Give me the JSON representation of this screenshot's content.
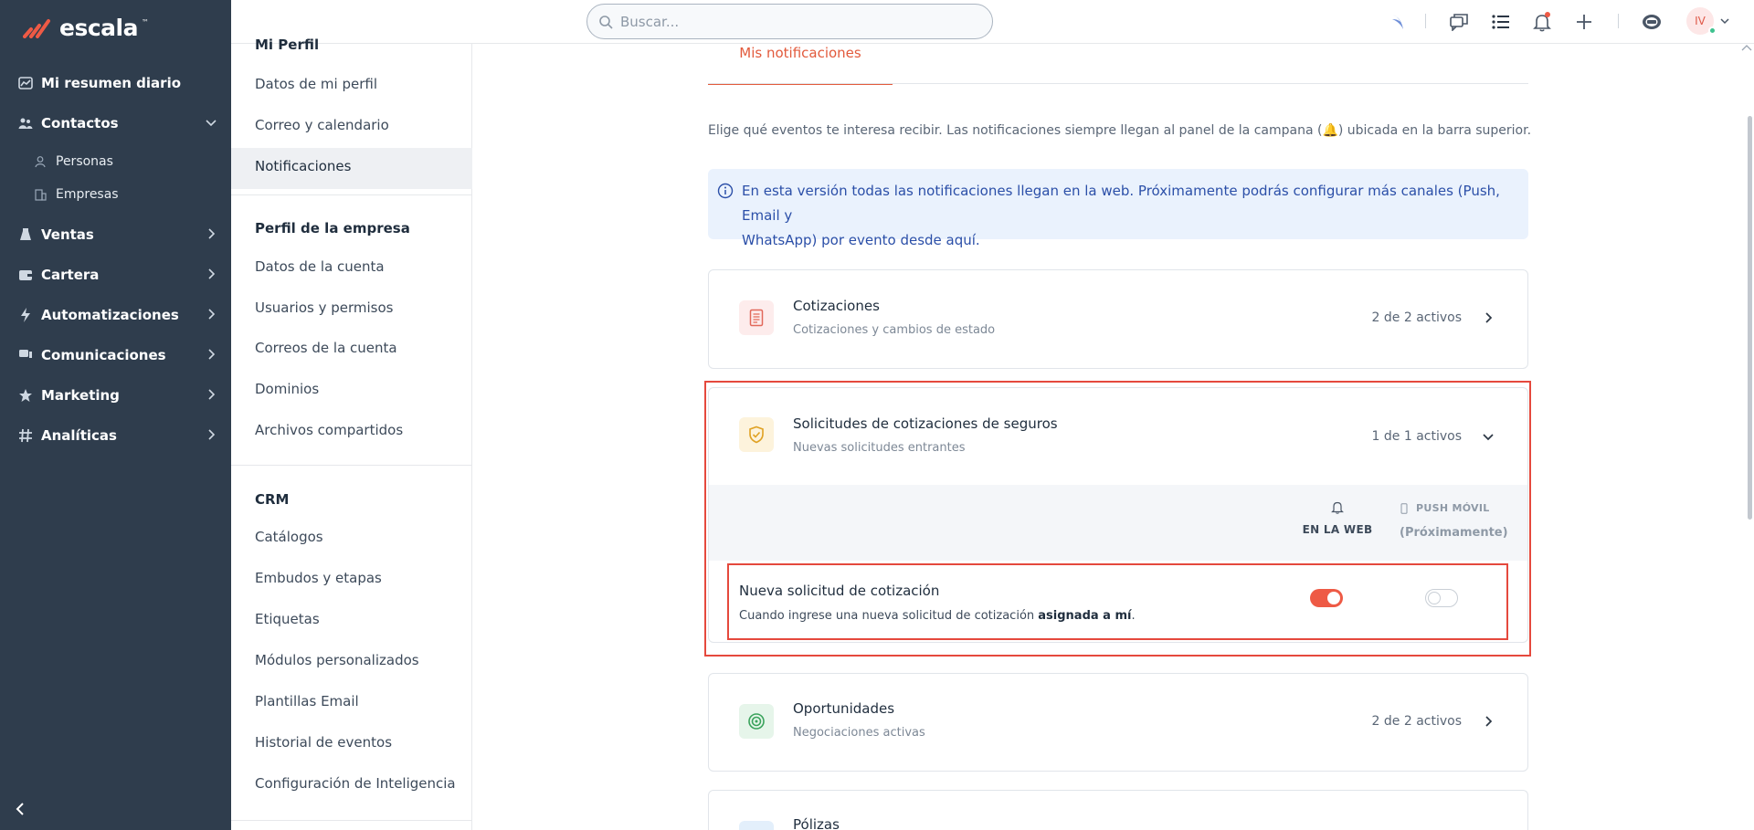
{
  "brand": {
    "name": "escala",
    "tm": "™"
  },
  "sidebar": {
    "items": [
      {
        "label": "Mi resumen diario"
      },
      {
        "label": "Contactos"
      },
      {
        "label": "Ventas"
      },
      {
        "label": "Cartera"
      },
      {
        "label": "Automatizaciones"
      },
      {
        "label": "Comunicaciones"
      },
      {
        "label": "Marketing"
      },
      {
        "label": "Analíticas"
      }
    ],
    "contact_sub": [
      {
        "label": "Personas"
      },
      {
        "label": "Empresas"
      }
    ]
  },
  "settings_menu": {
    "profile_heading": "Mi Perfil",
    "profile_items": [
      "Datos de mi perfil",
      "Correo y calendario",
      "Notificaciones"
    ],
    "company_heading": "Perfil de la empresa",
    "company_items": [
      "Datos de la cuenta",
      "Usuarios y permisos",
      "Correos de la cuenta",
      "Dominios",
      "Archivos compartidos"
    ],
    "crm_heading": "CRM",
    "crm_items": [
      "Catálogos",
      "Embudos y etapas",
      "Etiquetas",
      "Módulos personalizados",
      "Plantillas Email",
      "Historial de eventos",
      "Configuración de Inteligencia"
    ]
  },
  "topbar": {
    "search_placeholder": "Buscar...",
    "avatar_initials": "IV"
  },
  "main": {
    "tab": "Mis notificaciones",
    "intro_before": "Elige qué eventos te interesa recibir. Las notificaciones siempre llegan al panel de la campana (",
    "intro_emoji": "🔔",
    "intro_after": ") ubicada en la barra superior.",
    "info_line1": "En esta versión todas las notificaciones llegan en la web. Próximamente podrás configurar más canales (Push, Email y",
    "info_line2": "WhatsApp) por evento desde aquí.",
    "cards": [
      {
        "title": "Cotizaciones",
        "subtitle": "Cotizaciones y cambios de estado",
        "count": "2 de 2 activos"
      },
      {
        "title": "Solicitudes de cotizaciones de seguros",
        "subtitle": "Nuevas solicitudes entrantes",
        "count": "1 de 1 activos"
      },
      {
        "title": "Oportunidades",
        "subtitle": "Negociaciones activas",
        "count": "2 de 2 activos"
      },
      {
        "title": "Pólizas"
      }
    ],
    "channels": {
      "web": "EN LA WEB",
      "push": "PUSH MÓVIL",
      "push_soon": "(Próximamente)"
    },
    "event": {
      "title": "Nueva solicitud de cotización",
      "desc_before": "Cuando ingrese una nueva solicitud de cotización ",
      "desc_bold": "asignada a mí",
      "desc_after": ".",
      "web_enabled": true,
      "push_enabled": false
    }
  },
  "colors": {
    "accent": "#e25a3c",
    "sidebar_bg": "#2f3d4d",
    "toggle_on": "#ee5a45",
    "highlight": "#e5493d"
  }
}
